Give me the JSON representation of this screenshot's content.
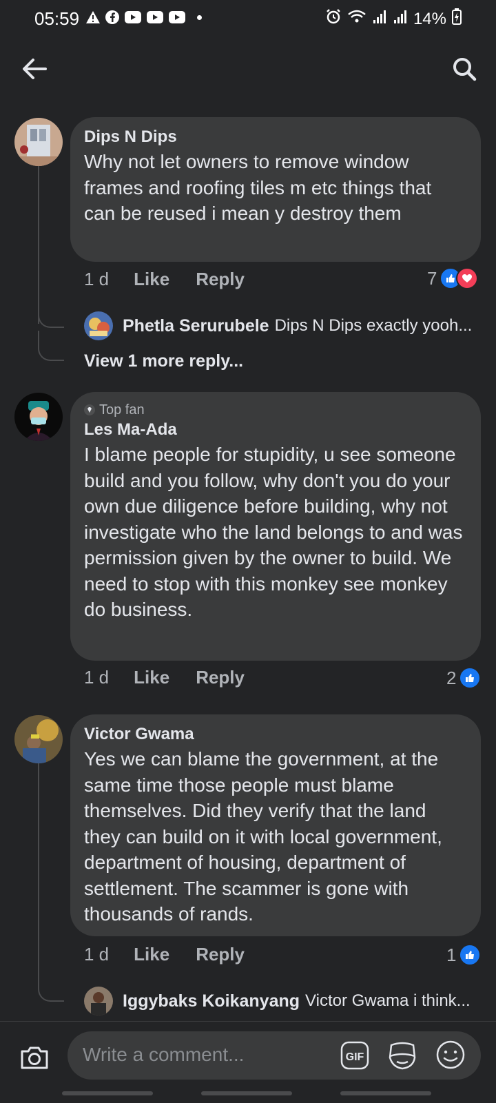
{
  "status_bar": {
    "time": "05:59",
    "battery": "14%"
  },
  "comments": [
    {
      "author": "Dips N Dips",
      "text": "Why not let owners to remove window frames and roofing tiles m etc things that can be reused i mean y destroy them",
      "time": "1 d",
      "like_label": "Like",
      "reply_label": "Reply",
      "reaction_count": "7",
      "reactions": [
        "like",
        "love"
      ],
      "reply_preview": {
        "author": "Phetla Serurubele",
        "text": "Dips N Dips exactly yooh..."
      },
      "view_more": "View 1 more reply..."
    },
    {
      "badge": "Top fan",
      "author": "Les Ma-Ada",
      "text": "I blame people for stupidity, u see someone build and you follow, why don't you do your own due diligence before building, why not investigate who the land belongs to and was permission given by the owner to build. We need to stop with this monkey see monkey do business.",
      "time": "1 d",
      "like_label": "Like",
      "reply_label": "Reply",
      "reaction_count": "2",
      "reactions": [
        "like"
      ]
    },
    {
      "author": "Victor Gwama",
      "text": "Yes we can blame the government, at the same time those people must blame themselves. Did they verify that the land they can build on it with local government, department of housing, department of settlement. The scammer is gone with thousands of rands.",
      "time": "1 d",
      "like_label": "Like",
      "reply_label": "Reply",
      "reaction_count": "1",
      "reactions": [
        "like"
      ],
      "reply_preview": {
        "author": "Iggybaks Koikanyang",
        "text": "Victor Gwama i think..."
      }
    }
  ],
  "composer": {
    "placeholder": "Write a comment...",
    "gif_label": "GIF"
  },
  "colors": {
    "background": "#232426",
    "bubble": "#3a3b3c",
    "like_blue": "#1877f2",
    "love_red": "#f33e58",
    "secondary_text": "#b0b3b8"
  }
}
